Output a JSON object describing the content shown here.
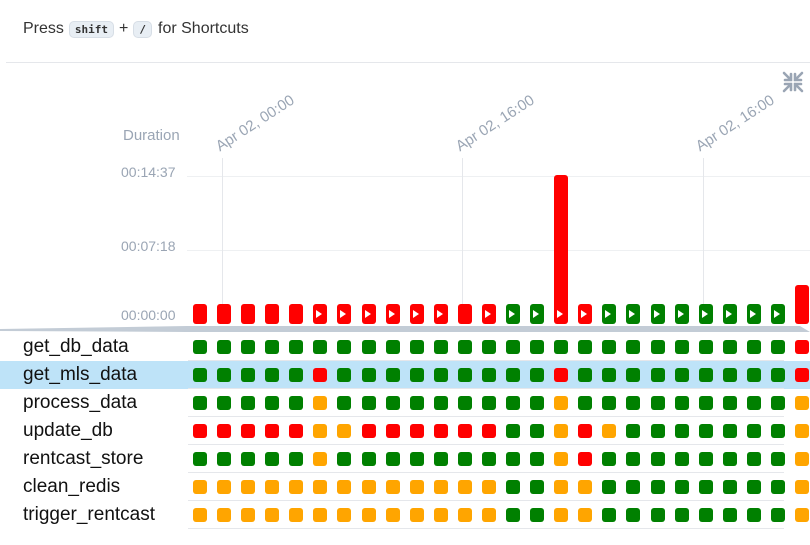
{
  "shortcut_hint": {
    "prefix": "Press",
    "key1": "shift",
    "plus": "+",
    "key2": "/",
    "suffix": "for Shortcuts"
  },
  "colors": {
    "success": "#008000",
    "failed": "#ff0000",
    "upstream_failed": "#ffa500",
    "selected_row": "#bee3f8",
    "axis_text": "#9aa5b4"
  },
  "icons": {
    "collapse": "collapse-arrows-icon",
    "running": "play-icon"
  },
  "chart": {
    "y_axis_title": "Duration",
    "y_ticks": [
      "00:14:37",
      "00:07:18",
      "00:00:00"
    ],
    "x_labels": [
      "Apr 02, 00:00",
      "Apr 02, 16:00",
      "Apr 02, 16:00"
    ]
  },
  "chart_data": {
    "type": "bar",
    "y_unit": "seconds",
    "ylim": [
      0,
      877
    ],
    "run_durations": [
      20,
      20,
      20,
      20,
      20,
      20,
      20,
      20,
      20,
      20,
      20,
      20,
      20,
      20,
      20,
      890,
      20,
      20,
      20,
      20,
      20,
      20,
      20,
      20,
      20,
      230
    ],
    "run_states": [
      "failed",
      "failed",
      "failed",
      "failed",
      "failed",
      "failed",
      "failed",
      "failed",
      "failed",
      "failed",
      "failed",
      "failed",
      "failed",
      "success",
      "success",
      "failed",
      "failed",
      "success",
      "success",
      "success",
      "success",
      "success",
      "success",
      "success",
      "success",
      "failed"
    ],
    "run_play_marker": [
      false,
      false,
      false,
      false,
      false,
      true,
      true,
      true,
      true,
      true,
      true,
      false,
      true,
      true,
      true,
      true,
      true,
      true,
      true,
      true,
      true,
      true,
      true,
      true,
      true,
      false
    ]
  },
  "tasks": [
    {
      "name": "get_db_data",
      "selected": false,
      "states": "GGGGGGGGGGGGGGGGGGGGGGGGGR"
    },
    {
      "name": "get_mls_data",
      "selected": true,
      "states": "GGGGGRGGGGGGGGGRGGGGGGGGGR"
    },
    {
      "name": "process_data",
      "selected": false,
      "states": "GGGGGOGGGGGGGGGOGGGGGGGGGO"
    },
    {
      "name": "update_db",
      "selected": false,
      "states": "RRRRROORRRRRRGGOROGGGGGGGO"
    },
    {
      "name": "rentcast_store",
      "selected": false,
      "states": "GGGGGOGGGGGGGGGORGGGGGGGGO"
    },
    {
      "name": "clean_redis",
      "selected": false,
      "states": "OOOOOOOOOOOOOGGOOGGGGGGGGO"
    },
    {
      "name": "trigger_rentcast",
      "selected": false,
      "states": "OOOOOOOOOOOOOGGOOGGGGGGGGO"
    }
  ]
}
